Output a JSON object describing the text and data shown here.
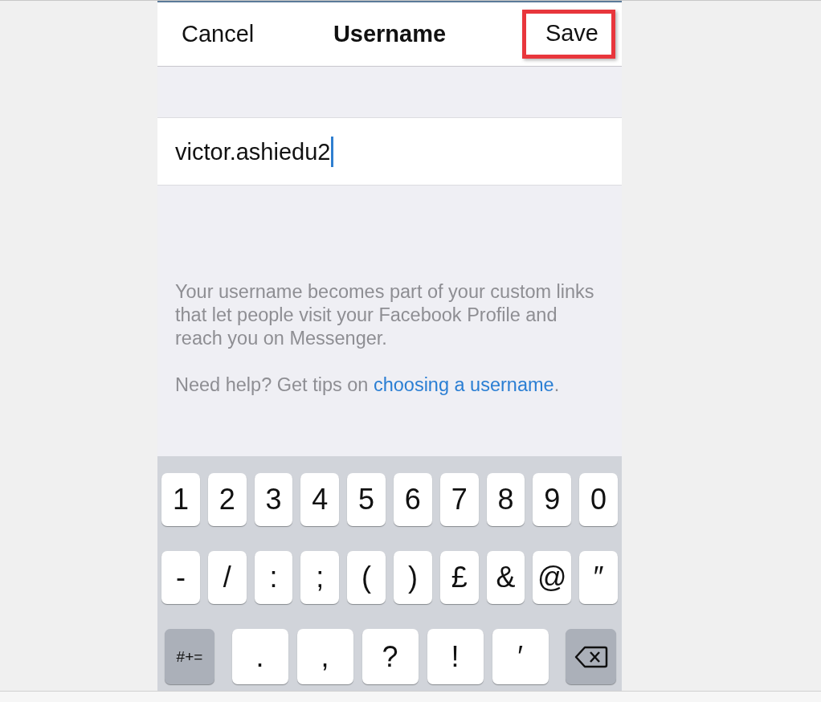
{
  "nav_bar": {
    "cancel": "Cancel",
    "title": "Username",
    "save": {
      "label": "Save",
      "highlighted": true
    }
  },
  "username_field": {
    "value": "victor.ashiedu2",
    "focused": true
  },
  "help": {
    "description": "Your username becomes part of your custom links that let people visit your Facebook Profile and reach you on Messenger.",
    "tip": "Need help? Get tips on",
    "link": "choosing a username",
    "end": "."
  },
  "keyboard": {
    "number_row": [
      "1",
      "2",
      "3",
      "4",
      "5",
      "6",
      "7",
      "8",
      "9",
      "0"
    ],
    "symbol_row": [
      "-",
      "/",
      ":",
      ";",
      "(",
      ")",
      "£",
      "&",
      "@",
      "″"
    ],
    "bottom_row": {
      "mode_key": "#+=",
      "punctuation": [
        ".",
        ",",
        "?",
        "!",
        "′"
      ]
    }
  }
}
